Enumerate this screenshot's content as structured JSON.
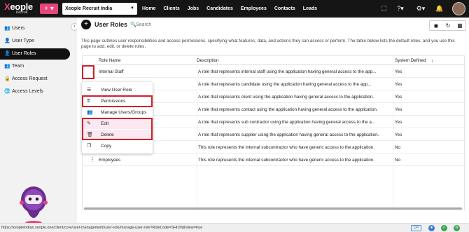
{
  "brand": {
    "logo_text_1": "X",
    "logo_text_2": "eople",
    "logo_sub": "recruit",
    "accent": "#e6457a"
  },
  "header": {
    "plus_label": "+ ▾",
    "org_select": "Xeople Recruit India",
    "nav": [
      "Home",
      "Clients",
      "Jobs",
      "Candidates",
      "Employees",
      "Contacts",
      "Leads"
    ]
  },
  "sidebar": {
    "items": [
      {
        "label": "Users",
        "icon": "users-icon"
      },
      {
        "label": "User Type",
        "icon": "user-type-icon"
      },
      {
        "label": "User Roles",
        "icon": "user-roles-icon",
        "active": true
      },
      {
        "label": "Team",
        "icon": "team-icon"
      },
      {
        "label": "Access Request",
        "icon": "access-request-icon"
      },
      {
        "label": "Access Levels",
        "icon": "access-levels-icon"
      }
    ]
  },
  "main": {
    "title": "User Roles",
    "search_placeholder": "Search",
    "description": "This page outlines user responsibilities and access permissions, specifying what features, data, and actions they can access or perform. The table below lists the default roles, and you use this page to add, edit, or delete roles.",
    "columns": {
      "role": "Role Name",
      "description": "Description",
      "system": "System Defined",
      "sort_arrow": "↓"
    },
    "rows": [
      {
        "role": "Internal Staff",
        "description": "A role that represents internal staff using the application having general access to the app...",
        "system": "Yes"
      },
      {
        "role": "",
        "description": "A role that represents candidate using the application having general access to the app...",
        "system": "Yes"
      },
      {
        "role": "",
        "description": "A role that represents client using the application having general access to the application.",
        "system": "Yes"
      },
      {
        "role": "",
        "description": "A role that represents contact using the application having general access to the application.",
        "system": "Yes"
      },
      {
        "role": "",
        "description": "A role that represents sub contractor using the application having general access to the a...",
        "system": "Yes"
      },
      {
        "role": "",
        "description": "A role that represents supplier using the application having general access to the application.",
        "system": "Yes"
      },
      {
        "role": "",
        "description": "This role represents the internal subcontractor who have generic access to the application.",
        "system": "No"
      },
      {
        "role": "Employees",
        "description": "This role represents the internal subcontractor who have generic access to the application.",
        "system": "No"
      }
    ]
  },
  "menu": {
    "items": [
      {
        "label": "View User Role",
        "icon": "list-icon"
      },
      {
        "label": "Permissions",
        "icon": "key-icon"
      },
      {
        "label": "Manage Users/Groups",
        "icon": "group-icon"
      },
      {
        "label": "Edit",
        "icon": "pencil-icon"
      },
      {
        "label": "Delete",
        "icon": "trash-icon"
      },
      {
        "label": "Copy",
        "icon": "copy-icon"
      }
    ]
  },
  "status": {
    "url": "https://xeopleindian.xeople.one/client/core/user-management/user-role/manage-user-role?RoleCode=SHION&View=true",
    "qa": "QA"
  }
}
